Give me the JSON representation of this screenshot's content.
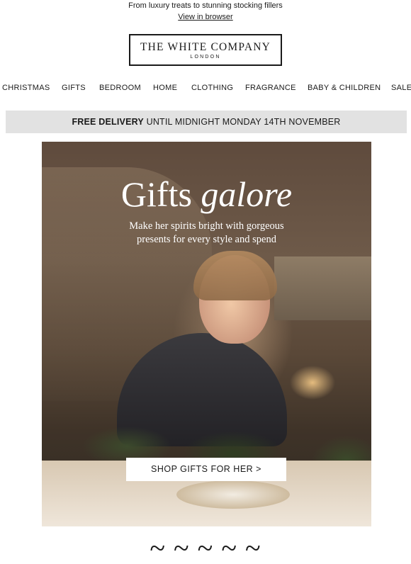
{
  "preheader": {
    "text": "From luxury treats to stunning stocking fillers",
    "view_in_browser": "View in browser"
  },
  "logo": {
    "brand": "THE WHITE COMPANY",
    "city": "LONDON"
  },
  "nav": {
    "items": [
      {
        "label": "CHRISTMAS"
      },
      {
        "label": "GIFTS"
      },
      {
        "label": "BEDROOM"
      },
      {
        "label": "HOME"
      },
      {
        "label": "CLOTHING"
      },
      {
        "label": "FRAGRANCE"
      },
      {
        "label": "BABY & CHILDREN"
      },
      {
        "label": "SALE"
      }
    ]
  },
  "banner": {
    "bold": "FREE DELIVERY",
    "rest": " UNTIL MIDNIGHT MONDAY 14TH NOVEMBER"
  },
  "hero": {
    "title_plain": "Gifts ",
    "title_italic": "galore",
    "subtitle_line1": "Make her spirits bright with gorgeous",
    "subtitle_line2": "presents for every style and spend",
    "cta": "SHOP GIFTS FOR HER >"
  },
  "next_section": {
    "peek_text": "~ ~ ~ ~ ~"
  },
  "colors": {
    "text": "#1a1a1a",
    "banner_bg": "#e2e2e2",
    "hero_text": "#ffffff"
  }
}
